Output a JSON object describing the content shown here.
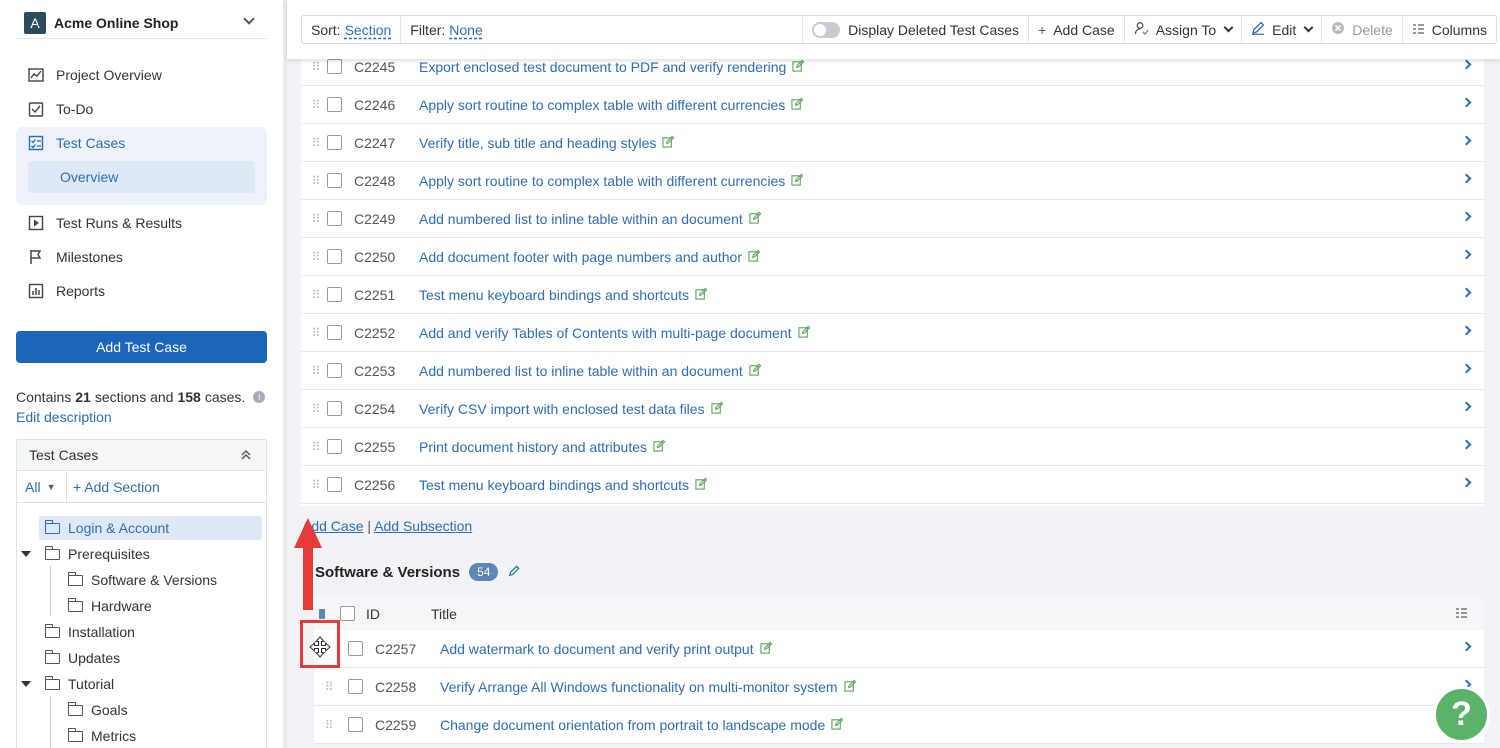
{
  "project": {
    "initial": "A",
    "name": "Acme Online Shop"
  },
  "nav": {
    "project_overview": "Project Overview",
    "todo": "To-Do",
    "test_cases": "Test Cases",
    "overview": "Overview",
    "test_runs": "Test Runs & Results",
    "milestones": "Milestones",
    "reports": "Reports"
  },
  "add_test_case_btn": "Add Test Case",
  "summary": {
    "prefix": "Contains",
    "sections": "21",
    "mid": "sections and",
    "cases": "158",
    "suffix": "cases.",
    "edit_description": "Edit description"
  },
  "tree": {
    "header": "Test Cases",
    "all": "All",
    "add_section": "+ Add Section",
    "items": [
      "Login & Account",
      "Prerequisites",
      "Software & Versions",
      "Hardware",
      "Installation",
      "Updates",
      "Tutorial",
      "Goals",
      "Metrics"
    ]
  },
  "toolbar": {
    "sort_label": "Sort:",
    "sort_value": "Section",
    "filter_label": "Filter:",
    "filter_value": "None",
    "display_deleted": "Display Deleted Test Cases",
    "add_case": "Add Case",
    "assign_to": "Assign To",
    "edit": "Edit",
    "delete": "Delete",
    "columns": "Columns"
  },
  "rows": [
    {
      "id": "C2245",
      "title": "Export enclosed test document to PDF and verify rendering"
    },
    {
      "id": "C2246",
      "title": "Apply sort routine to complex table with different currencies"
    },
    {
      "id": "C2247",
      "title": "Verify title, sub title and heading styles"
    },
    {
      "id": "C2248",
      "title": "Apply sort routine to complex table with different currencies"
    },
    {
      "id": "C2249",
      "title": "Add numbered list to inline table within an document"
    },
    {
      "id": "C2250",
      "title": "Add document footer with page numbers and author"
    },
    {
      "id": "C2251",
      "title": "Test menu keyboard bindings and shortcuts"
    },
    {
      "id": "C2252",
      "title": "Add and verify Tables of Contents with multi-page document"
    },
    {
      "id": "C2253",
      "title": "Add numbered list to inline table within an document"
    },
    {
      "id": "C2254",
      "title": "Verify CSV import with enclosed test data files"
    },
    {
      "id": "C2255",
      "title": "Print document history and attributes"
    },
    {
      "id": "C2256",
      "title": "Test menu keyboard bindings and shortcuts"
    }
  ],
  "add_links": {
    "add_case": "Add Case",
    "sep": "|",
    "add_subsection": "Add Subsection"
  },
  "section2": {
    "title": "Software & Versions",
    "count": "54",
    "col_id": "ID",
    "col_title": "Title",
    "rows": [
      {
        "id": "C2257",
        "title": "Add watermark to document and verify print output"
      },
      {
        "id": "C2258",
        "title": "Verify Arrange All Windows functionality on multi-monitor system"
      },
      {
        "id": "C2259",
        "title": "Change document orientation from portrait to landscape mode"
      }
    ]
  },
  "help": "?",
  "colors": {
    "accent": "#1c65b8",
    "link": "#2d6db5",
    "highlight": "#e53b3b",
    "help": "#5bb369"
  }
}
